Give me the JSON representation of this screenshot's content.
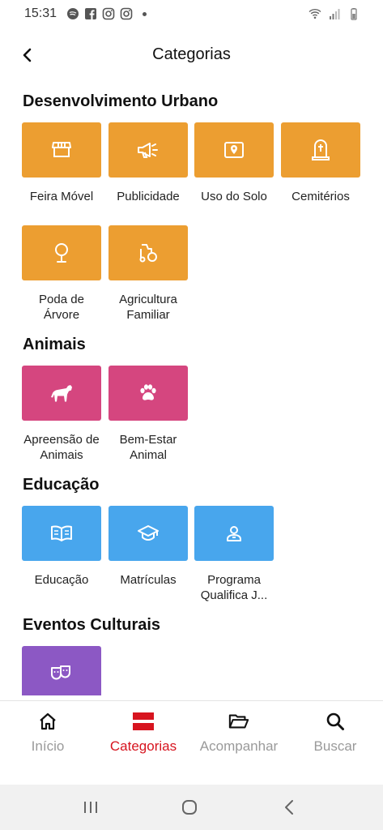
{
  "status_bar": {
    "time": "15:31",
    "left_icons": [
      "spotify-icon",
      "facebook-icon",
      "instagram-icon",
      "instagram-icon"
    ],
    "right_icons": [
      "wifi-icon",
      "signal-icon",
      "battery-icon"
    ]
  },
  "header": {
    "title": "Categorias"
  },
  "sections": {
    "urban": {
      "title": "Desenvolvimento Urbano",
      "color": "#EC9E31",
      "items": [
        {
          "label": "Feira Móvel",
          "icon": "storefront-icon"
        },
        {
          "label": "Publicidade",
          "icon": "megaphone-icon"
        },
        {
          "label": "Uso do Solo",
          "icon": "map-pin-icon"
        },
        {
          "label": "Cemitérios",
          "icon": "tombstone-icon"
        },
        {
          "label": "Poda de Árvore",
          "icon": "tree-icon"
        },
        {
          "label": "Agricultura Familiar",
          "icon": "agriculture-icon"
        }
      ]
    },
    "animals": {
      "title": "Animais",
      "color": "#D5467F",
      "items": [
        {
          "label": "Apreensão de Animais",
          "icon": "horse-icon"
        },
        {
          "label": "Bem-Estar Animal",
          "icon": "paw-icon"
        }
      ]
    },
    "education": {
      "title": "Educação",
      "color": "#48A6ED",
      "items": [
        {
          "label": "Educação",
          "icon": "book-icon"
        },
        {
          "label": "Matrículas",
          "icon": "graduation-cap-icon"
        },
        {
          "label": "Programa Qualifica J...",
          "icon": "person-icon"
        }
      ]
    },
    "culture": {
      "title": "Eventos Culturais",
      "color": "#8C58C4",
      "items": [
        {
          "label": "",
          "icon": "theater-masks-icon"
        }
      ]
    }
  },
  "bottom_nav": {
    "active": "categories",
    "active_color": "#D7141F",
    "items": [
      {
        "label": "Início",
        "icon": "home-icon"
      },
      {
        "label": "Categorias",
        "icon": "categories-icon"
      },
      {
        "label": "Acompanhar",
        "icon": "folder-open-icon"
      },
      {
        "label": "Buscar",
        "icon": "search-icon"
      }
    ]
  },
  "system_nav": {
    "buttons": [
      "recent-apps-icon",
      "home-circle-icon",
      "back-chevron-icon"
    ]
  }
}
